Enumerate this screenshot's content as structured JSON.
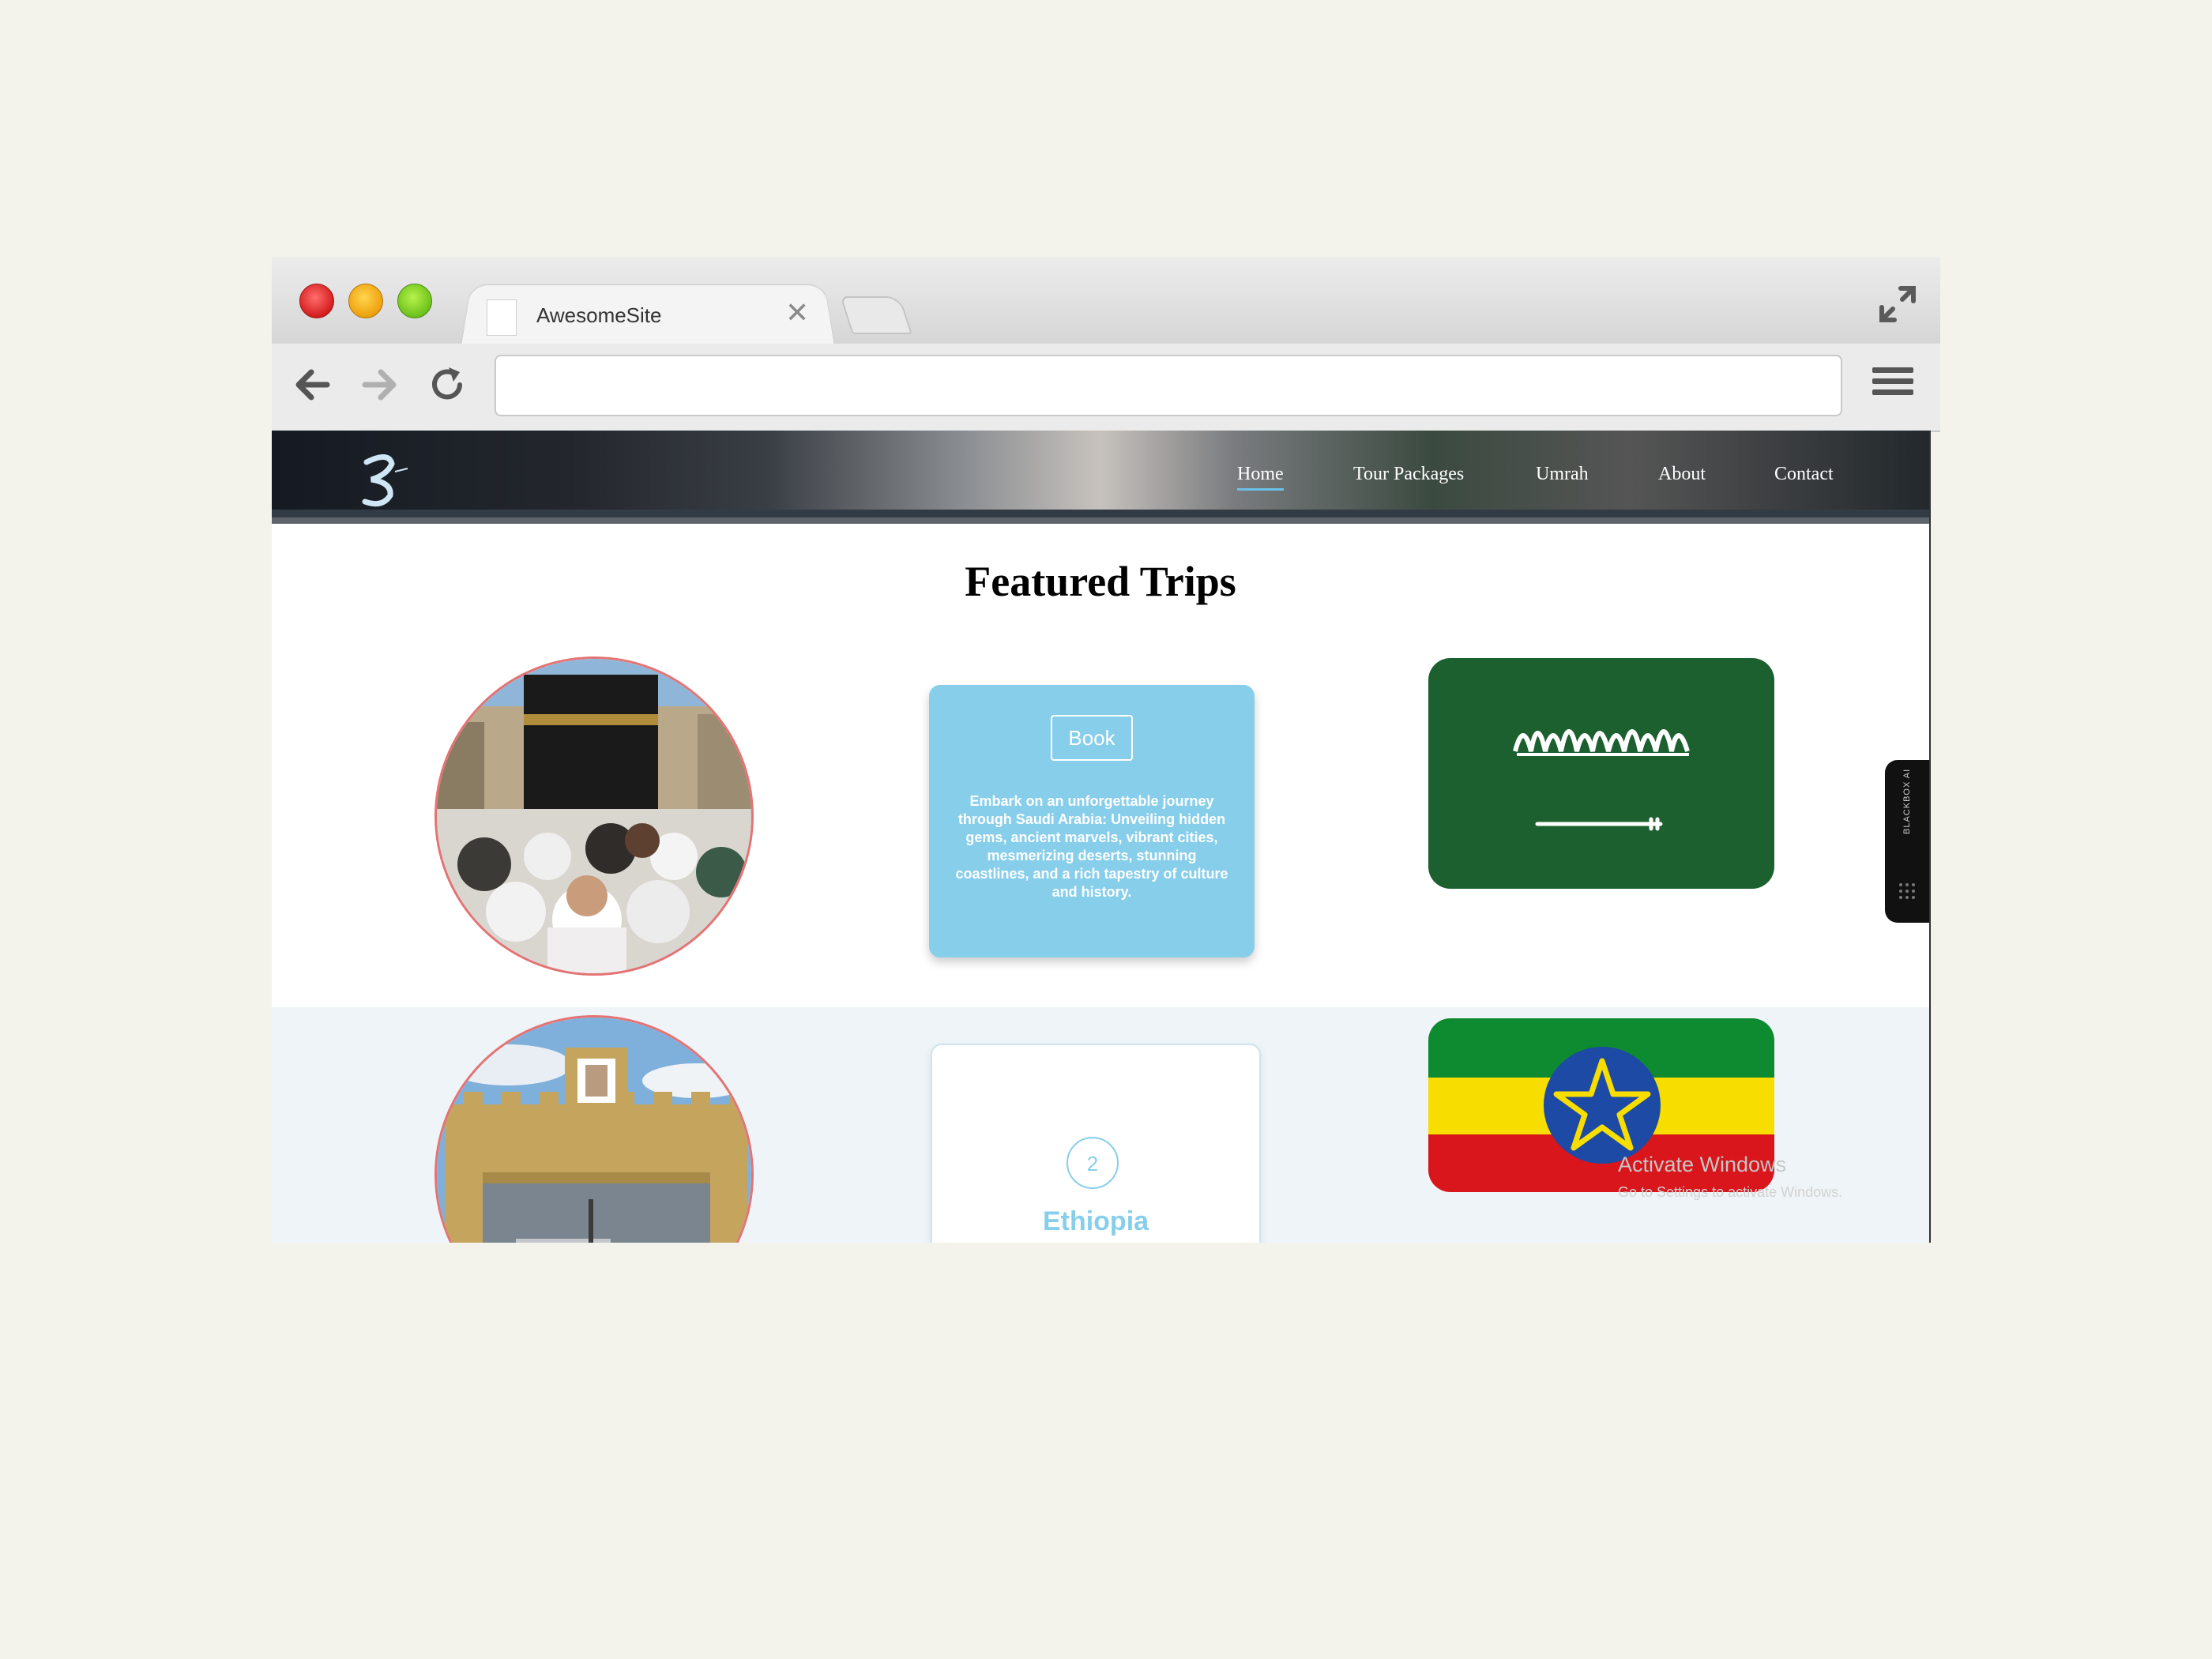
{
  "browser": {
    "tab_title": "AwesomeSite",
    "tab_close": "✕",
    "url": ""
  },
  "site": {
    "nav": [
      "Home",
      "Tour Packages",
      "Umrah",
      "About",
      "Contact"
    ],
    "active_nav": "Home",
    "section_title": "Featured Trips"
  },
  "trips": [
    {
      "book_label": "Book",
      "description": "Embark on an unforgettable journey through Saudi Arabia: Unveiling hidden gems, ancient marvels, vibrant cities, mesmerizing deserts, stunning coastlines, and a rich tapestry of culture and history."
    },
    {
      "number": "2",
      "name": "Ethiopia"
    }
  ],
  "overlay": {
    "activate_title": "Activate Windows",
    "activate_sub": "Go to Settings to activate Windows.",
    "blackbox_label": "BLACKBOX AI"
  },
  "colors": {
    "accent": "#87ceeb",
    "circle_border": "#e57373",
    "saudi_green": "#1c6030"
  }
}
